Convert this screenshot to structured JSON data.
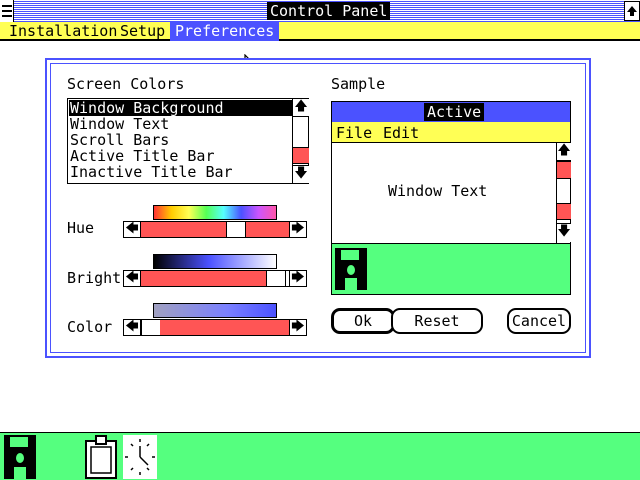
{
  "window": {
    "title": "Control Panel"
  },
  "menu": [
    "Installation",
    "Setup",
    "Preferences"
  ],
  "menu_active_index": 2,
  "dialog": {
    "screen_colors_label": "Screen Colors",
    "sample_label": "Sample",
    "list_items": [
      "Window Background",
      "Window Text",
      "Scroll Bars",
      "Active Title Bar",
      "Inactive Title Bar"
    ],
    "selected_index": 0,
    "sliders": [
      {
        "label": "Hue",
        "value_fraction": 0.62
      },
      {
        "label": "Bright",
        "value_fraction": 0.98
      },
      {
        "label": "Color",
        "value_fraction": 0.08
      }
    ],
    "sample": {
      "title": "Active",
      "menu": [
        "File",
        "Edit"
      ],
      "client_text": "Window Text"
    },
    "buttons": {
      "ok": "Ok",
      "reset": "Reset",
      "cancel": "Cancel"
    }
  },
  "icons": [
    "disk-icon",
    "clipboard-icon",
    "clock-icon"
  ],
  "colors": {
    "title_blue": "#4b52ff",
    "menu_yellow": "#ffff55",
    "scroll_red": "#ff5555",
    "desktop_green": "#55ff7f"
  }
}
